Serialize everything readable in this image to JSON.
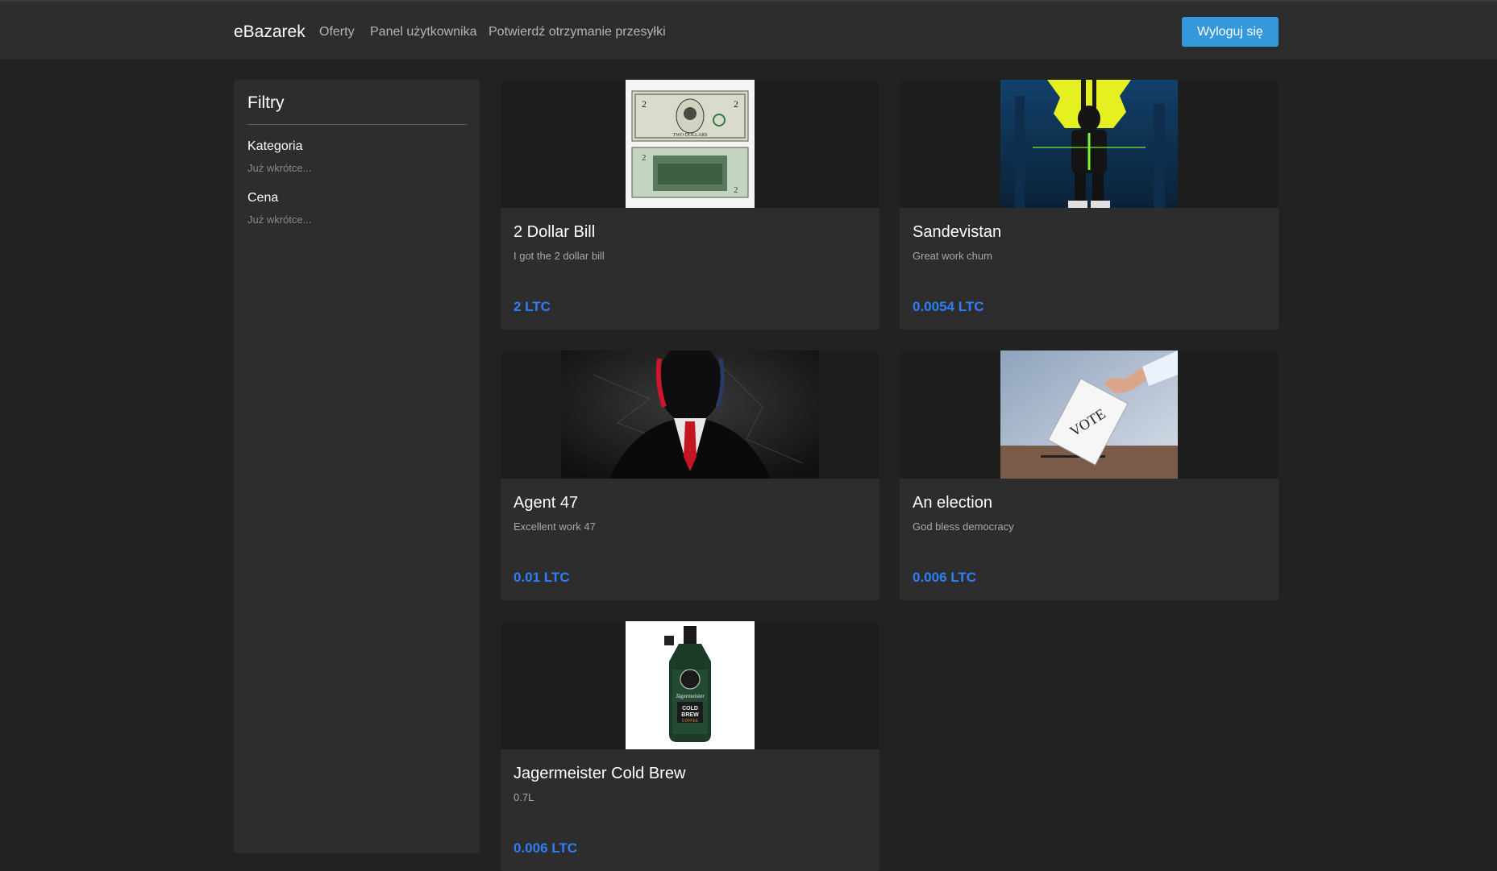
{
  "nav": {
    "brand": "eBazarek",
    "links": [
      "Oferty",
      "Panel użytkownika",
      "Potwierdź otrzymanie przesyłki"
    ],
    "logout": "Wyloguj się"
  },
  "sidebar": {
    "title": "Filtry",
    "filters": [
      {
        "label": "Kategoria",
        "hint": "Już wkrótce..."
      },
      {
        "label": "Cena",
        "hint": "Już wkrótce..."
      }
    ]
  },
  "listings": [
    {
      "title": "2 Dollar Bill",
      "description": "I got the 2 dollar bill",
      "price": "2 LTC"
    },
    {
      "title": "Sandevistan",
      "description": "Great work chum",
      "price": "0.0054 LTC"
    },
    {
      "title": "Agent 47",
      "description": "Excellent work 47",
      "price": "0.01 LTC"
    },
    {
      "title": "An election",
      "description": "God bless democracy",
      "price": "0.006 LTC"
    },
    {
      "title": "Jagermeister Cold Brew",
      "description": "0.7L",
      "price": "0.006 LTC"
    }
  ],
  "colors": {
    "accent": "#3498db",
    "price": "#2d7ff9",
    "background": "#222222",
    "panel": "#2d2d2d"
  },
  "bill_text": "TWO DOLLARS",
  "vote_text": "VOTE",
  "bottle_label": [
    "Jägermeister",
    "COLD",
    "BREW",
    "COFFEE"
  ]
}
